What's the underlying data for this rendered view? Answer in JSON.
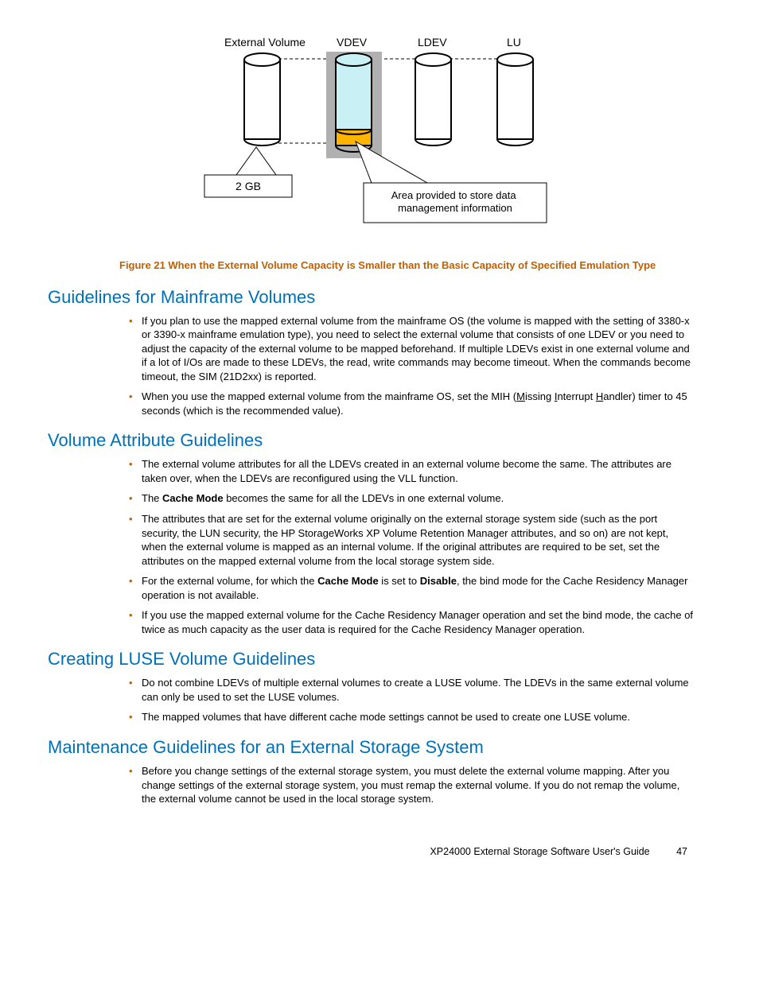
{
  "figure": {
    "labels": {
      "external_volume": "External Volume",
      "vdev": "VDEV",
      "ldev": "LDEV",
      "lu": "LU",
      "cap": "2 GB",
      "note": "Area provided to store data management information"
    },
    "caption": "Figure 21 When the External Volume Capacity is Smaller than the Basic Capacity of Specified Emulation Type"
  },
  "sections": {
    "s1": {
      "title": "Guidelines for Mainframe Volumes",
      "items": [
        "If you plan to use the mapped external volume from the mainframe OS (the volume is mapped with the setting of 3380-x or 3390-x mainframe emulation type), you need to select the external volume that consists of one LDEV or you need to adjust the capacity of the external volume to be mapped beforehand. If multiple LDEVs exist in one external volume and if a lot of I/Os are made to these LDEVs, the read, write commands may become timeout. When the commands become timeout, the SIM (21D2xx) is reported.",
        "__HTML__When you use the mapped external volume from the mainframe OS, set the MIH (<span class=\"under\">M</span>issing <span class=\"under\">I</span>nterrupt <span class=\"under\">H</span>andler) timer to 45 seconds (which is the recommended value)."
      ]
    },
    "s2": {
      "title": "Volume Attribute Guidelines",
      "items": [
        "The external volume attributes for all the LDEVs created in an external volume become the same. The attributes are taken over, when the LDEVs are reconfigured using the VLL function.",
        "__HTML__The <b>Cache Mode</b> becomes the same for all the LDEVs in one external volume.",
        "The attributes that are set for the external volume originally on the external storage system side (such as the port security, the LUN security, the HP StorageWorks XP Volume Retention Manager attributes, and so on) are not kept, when the external volume is mapped as an internal volume. If the original attributes are required to be set, set the attributes on the mapped external volume from the local storage system side.",
        "__HTML__For the external volume, for which the <b>Cache Mode</b> is set to <b>Disable</b>, the bind mode for the Cache Residency Manager operation is not available.",
        "If you use the mapped external volume for the Cache Residency Manager operation and set the bind mode, the cache of twice as much capacity as the user data is required for the Cache Residency Manager operation."
      ]
    },
    "s3": {
      "title": "Creating LUSE Volume Guidelines",
      "items": [
        "Do not combine LDEVs of multiple external volumes to create a LUSE volume. The LDEVs in the same external volume can only be used to set the LUSE volumes.",
        "The mapped volumes that have different cache mode settings cannot be used to create one LUSE volume."
      ]
    },
    "s4": {
      "title": "Maintenance Guidelines for an External Storage System",
      "items": [
        "Before you change settings of the external storage system, you must delete the external volume mapping. After you change settings of the external storage system, you must remap the external volume. If you do not remap the volume, the external volume cannot be used in the local storage system."
      ]
    }
  },
  "footer": {
    "doc": "XP24000 External Storage Software User's Guide",
    "page": "47"
  }
}
